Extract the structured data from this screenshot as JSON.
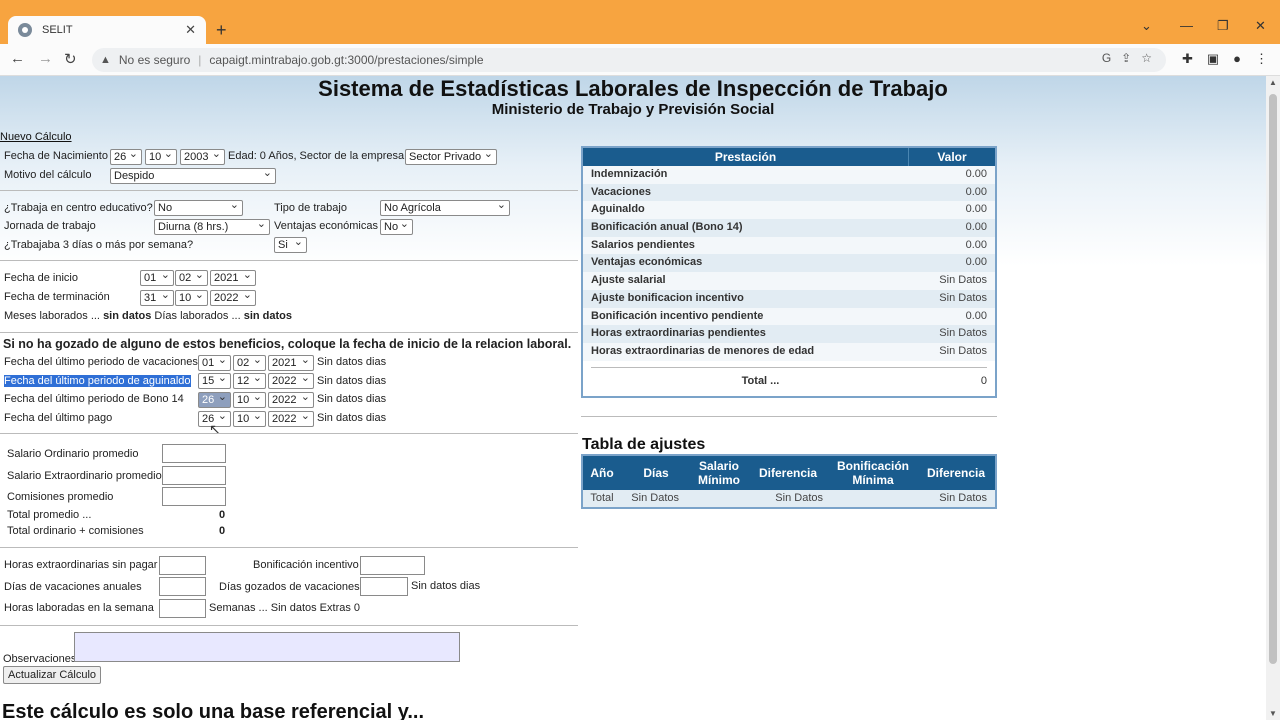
{
  "browser": {
    "tab_title": "SELIT",
    "address_warning": "No es seguro",
    "url": "capaigt.mintrabajo.gob.gt:3000/prestaciones/simple"
  },
  "header": {
    "title": "Sistema de Estadísticas Laborales de Inspección de Trabajo",
    "subtitle": "Ministerio de Trabajo y Previsión Social"
  },
  "form": {
    "nuevo_calculo": "Nuevo Cálculo",
    "nacimiento_label": "Fecha de Nacimiento",
    "nacimiento_dia": "26",
    "nacimiento_mes": "10",
    "nacimiento_anio": "2003",
    "edad_text": "Edad: 0 Años, Sector de la empresa",
    "sector": "Sector Privado",
    "motivo_label": "Motivo del cálculo",
    "motivo": "Despido",
    "centro_educativo_label": "¿Trabaja en centro educativo?",
    "centro_educativo": "No",
    "tipo_trabajo_label": "Tipo de trabajo",
    "tipo_trabajo": "No Agrícola",
    "jornada_label": "Jornada de trabajo",
    "jornada": "Diurna (8 hrs.)",
    "ventajas_label": "Ventajas económicas",
    "ventajas": "No",
    "tres_dias_label": "¿Trabajaba 3 días o más por semana?",
    "tres_dias": "Si",
    "inicio_label": "Fecha de inicio",
    "inicio": [
      "01",
      "02",
      "2021"
    ],
    "terminacion_label": "Fecha de terminación",
    "terminacion": [
      "31",
      "10",
      "2022"
    ],
    "meses_label": "Meses laborados ...",
    "meses_value": "sin datos",
    "dias_label": "Días laborados ...",
    "dias_value": "sin datos",
    "beneficios_notice": "Si no ha gozado de alguno de estos beneficios, coloque la fecha de inicio de la relacion laboral.",
    "vacaciones_label": "Fecha del último periodo de vacaciones",
    "vacaciones": [
      "01",
      "02",
      "2021"
    ],
    "vacaciones_dias": "Sin datos dias",
    "aguinaldo_label": "Fecha del último periodo de aguinaldo",
    "aguinaldo": [
      "15",
      "12",
      "2022"
    ],
    "aguinaldo_dias": "Sin datos dias",
    "bono14_label": "Fecha del último periodo de Bono 14",
    "bono14": [
      "26",
      "10",
      "2022"
    ],
    "bono14_dias": "Sin datos dias",
    "ultimo_pago_label": "Fecha del último pago",
    "ultimo_pago": [
      "26",
      "10",
      "2022"
    ],
    "ultimo_pago_dias": "Sin datos dias",
    "salario_ordinario_label": "Salario Ordinario promedio",
    "salario_extra_label": "Salario Extraordinario promedio",
    "comisiones_label": "Comisiones promedio",
    "total_promedio_label": "Total promedio ...",
    "total_promedio": "0",
    "total_ordinario_label": "Total ordinario + comisiones",
    "total_ordinario": "0",
    "horas_sin_pagar_label": "Horas extraordinarias sin pagar",
    "bonificacion_incentivo_label": "Bonificación incentivo",
    "dias_vacaciones_label": "Días de vacaciones anuales",
    "dias_gozados_label": "Días gozados de vacaciones",
    "dias_gozados_text": "Sin datos dias",
    "horas_semana_label": "Horas laboradas en la semana",
    "semanas_text": "Semanas ... Sin datos Extras 0",
    "observaciones_label": "Observaciones",
    "actualizar_button": "Actualizar Cálculo",
    "cut_off_text": "Este cálculo es solo una base referencial y..."
  },
  "prestaciones": {
    "col1": "Prestación",
    "col2": "Valor",
    "rows": [
      {
        "name": "Indemnización",
        "value": "0.00"
      },
      {
        "name": "Vacaciones",
        "value": "0.00"
      },
      {
        "name": "Aguinaldo",
        "value": "0.00"
      },
      {
        "name": "Bonificación anual (Bono 14)",
        "value": "0.00"
      },
      {
        "name": "Salarios pendientes",
        "value": "0.00"
      },
      {
        "name": "Ventajas económicas",
        "value": "0.00"
      },
      {
        "name": "Ajuste salarial",
        "value": "Sin Datos"
      },
      {
        "name": "Ajuste bonificacion incentivo",
        "value": "Sin Datos"
      },
      {
        "name": "Bonificación incentivo pendiente",
        "value": "0.00"
      },
      {
        "name": "Horas extraordinarias pendientes",
        "value": "Sin Datos"
      },
      {
        "name": "Horas extraordinarias de menores de edad",
        "value": "Sin Datos"
      }
    ],
    "total_label": "Total ...",
    "total_value": "0"
  },
  "ajustes": {
    "title": "Tabla de ajustes",
    "headers": [
      "Año",
      "Días",
      "Salario Mínimo",
      "Diferencia",
      "Bonificación Mínima",
      "Diferencia"
    ],
    "row": [
      "Total",
      "Sin Datos",
      "",
      "Sin Datos",
      "",
      "Sin Datos"
    ]
  }
}
